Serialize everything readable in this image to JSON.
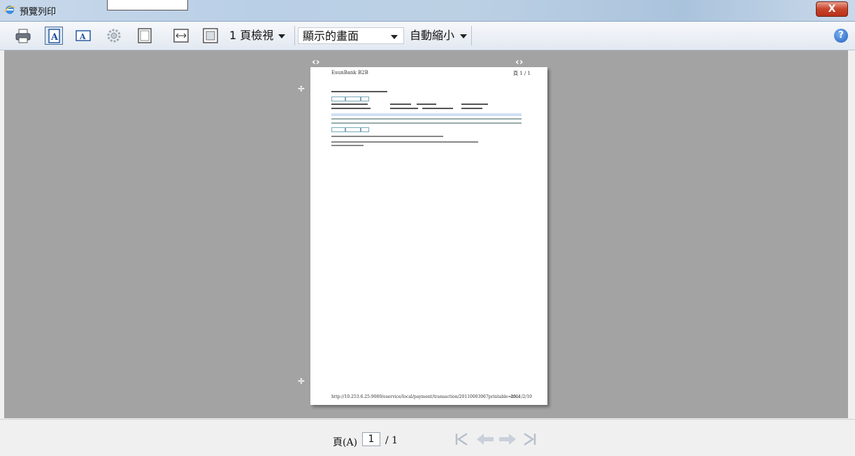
{
  "window": {
    "title": "預覽列印",
    "close_label": "X"
  },
  "toolbar": {
    "buttons": [
      "print-icon",
      "portrait-icon",
      "landscape-icon",
      "page-setup-icon",
      "header-footer-icon",
      "full-width-icon",
      "full-page-icon"
    ],
    "view_mode": "1 頁檢視",
    "print_what": "顯示的畫面",
    "zoom": "自動縮小",
    "help_label": "?"
  },
  "document": {
    "header_left": "EsunBank B2B",
    "header_right": "頁 1 / 1",
    "footer_url": "http://10.253.6.25:9080/eservice/local/payment/transaction/20110003067printable=true",
    "footer_date": "2011/2/10"
  },
  "status": {
    "page_label": "頁(A)",
    "current_page": "1",
    "total_pages": "/ 1"
  },
  "colors": {
    "preview_background": "#a3a3a3",
    "close_button": "#c7442a",
    "nav_arrows_disabled": "#b8c0cc"
  }
}
